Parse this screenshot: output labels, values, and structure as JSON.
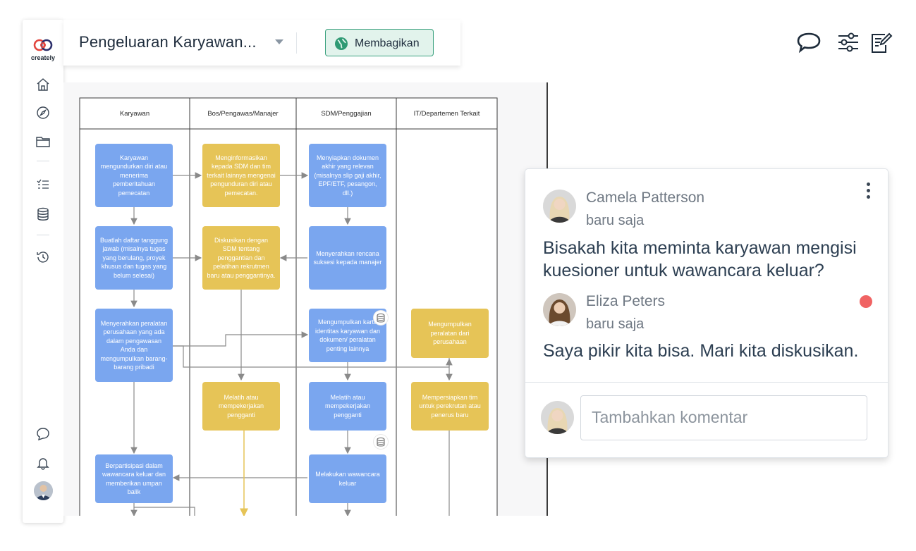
{
  "app": {
    "logo_text": "creately"
  },
  "sidebar": {
    "items": [
      {
        "icon": "home-icon"
      },
      {
        "icon": "compass-icon"
      },
      {
        "icon": "folder-icon"
      },
      {
        "icon": "checklist-icon"
      },
      {
        "icon": "database-icon"
      },
      {
        "icon": "history-icon"
      }
    ],
    "bottom": [
      {
        "icon": "chat-icon"
      },
      {
        "icon": "bell-icon"
      },
      {
        "icon": "user-avatar"
      }
    ]
  },
  "header": {
    "doc_title": "Pengeluaran Karyawan...",
    "share_label": "Membagikan",
    "right_icons": [
      "comment-icon",
      "filter-sliders-icon",
      "edit-note-icon"
    ]
  },
  "diagram": {
    "lanes": [
      "Karyawan",
      "Bos/Pengawas/Manajer",
      "SDM/Penggajian",
      "IT/Departemen Terkait"
    ],
    "nodes": {
      "n1": "Karyawan mengundurkan diri atau menerima pemberitahuan pemecatan",
      "n2": "Menginformasikan kepada SDM dan tim terkait lainnya mengenai pengunduran diri atau pemecatan.",
      "n3": "Menyiapkan dokumen akhir yang relevan (misalnya slip gaji akhir, EPF/ETF, pesangon, dll.)",
      "n4": "Buatlah daftar tanggung jawab (misalnya tugas yang berulang, proyek khusus dan tugas yang belum selesai)",
      "n5": "Diskusikan dengan SDM tentang penggantian dan pelatihan rekrutmen baru atau penggantinya.",
      "n6": "Menyerahkan rencana suksesi kepada manajer",
      "n7": "Menyerahkan peralatan perusahaan yang ada dalam pengawasan Anda dan mengumpulkan barang-barang pribadi",
      "n8": "Mengumpulkan kartu identitas karyawan dan dokumen/ peralatan penting lainnya",
      "n9": "Mengumpulkan peralatan dari perusahaan",
      "n10": "Melatih atau mempekerjakan pengganti",
      "n11": "Melatih atau mempekerjakan pengganti",
      "n12": "Mempersiapkan tim untuk perekrutan atau penerus baru",
      "n13": "Berpartisipasi dalam wawancara keluar dan memberikan umpan balik",
      "n14": "Melakukan wawancara keluar"
    },
    "colors": {
      "blue": "#7aa6ef",
      "yellow": "#e6c457"
    }
  },
  "comments": {
    "items": [
      {
        "author": "Camela Patterson",
        "time": "baru saja",
        "text_line1": "Bisakah kita meminta karyawan mengisi",
        "text_line2": "kuesioner untuk wawancara keluar?"
      },
      {
        "author": "Eliza Peters",
        "time": "baru saja",
        "text": "Saya pikir kita bisa. Mari kita diskusikan.",
        "unread": true
      }
    ],
    "input_placeholder": "Tambahkan komentar",
    "unread_color": "#f06363"
  }
}
